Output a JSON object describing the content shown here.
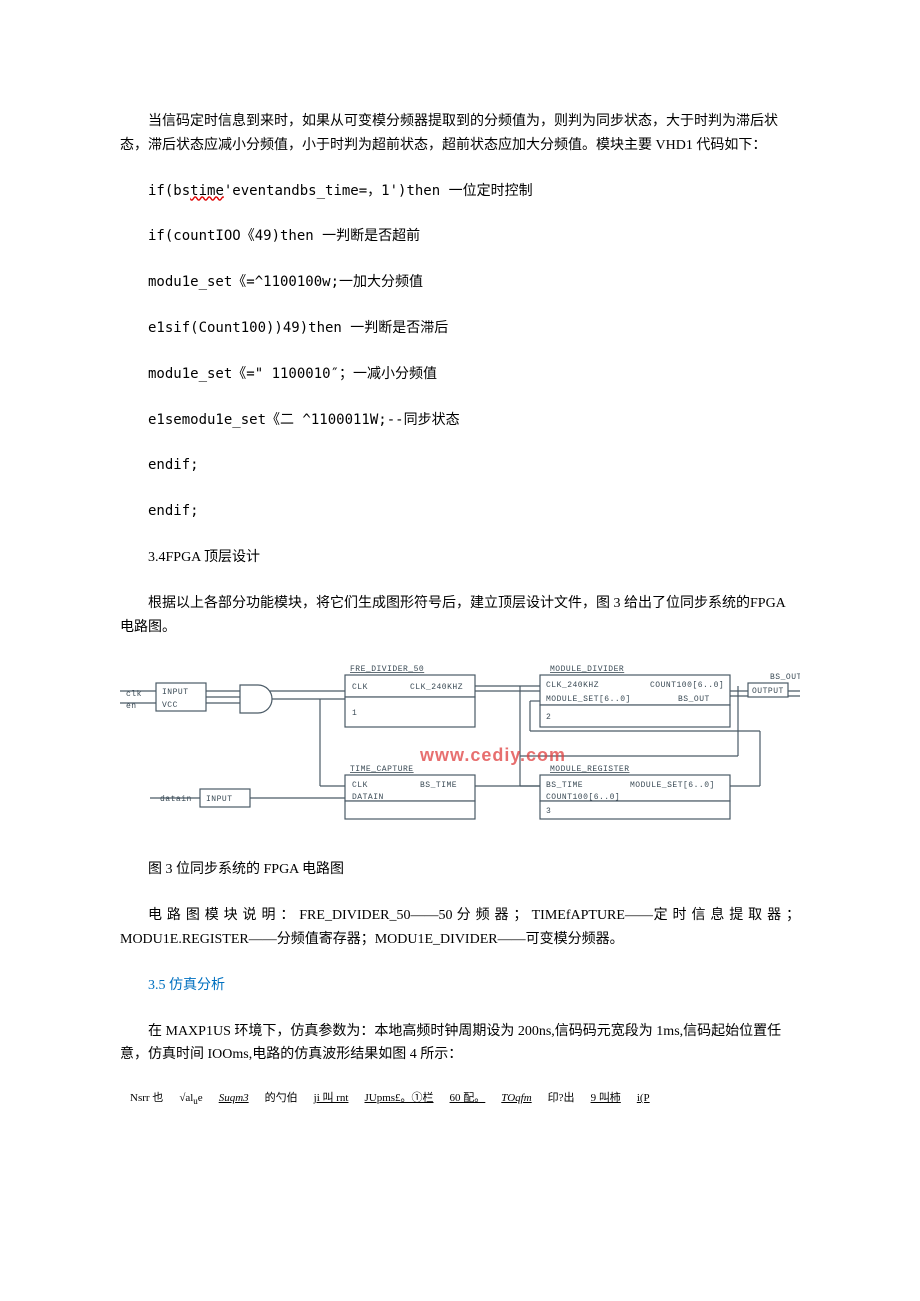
{
  "para_intro": "当信码定时信息到来时，如果从可变模分频器提取到的分频值为，则判为同步状态，大于时判为滞后状态，滞后状态应减小分频值，小于时判为超前状态，超前状态应加大分频值。模块主要 VHD1 代码如下：",
  "code": {
    "l1_a": "if(bs",
    "l1_b": "time",
    "l1_c": "'eventandbs_time=，1')then 一位定时控制",
    "l2": "if(countIOO《49)then 一判断是否超前",
    "l3": "modu1e_set《=^1100100w;一加大分频值",
    "l4": "e1sif(Count100))49)then 一判断是否滞后",
    "l5": "modu1e_set《=\" 1100010″；一减小分频值",
    "l6": "e1semodu1e_set《二 ^1100011W;--同步状态",
    "l7": "endif;",
    "l8": "endif;"
  },
  "heading34": "3.4FPGA 顶层设计",
  "para34": "根据以上各部分功能模块，将它们生成图形符号后，建立顶层设计文件，图 3 给出了位同步系统的FPGA 电路图。",
  "diagram": {
    "blocks": {
      "fre_divider": "FRE_DIVIDER_50",
      "module_divider": "MODULE_DIVIDER",
      "time_capture": "TIME_CAPTURE",
      "module_register": "MODULE_REGISTER"
    },
    "ports": {
      "clk": "clk",
      "en": "en",
      "datain": "datain",
      "bs_out_pin": "BS_OUT",
      "clk_port": "CLK",
      "clk_240khz": "CLK_240KHZ",
      "module_set": "MODULE_SET[6..0]",
      "count100": "COUNT100[6..0]",
      "bs_out": "BS_OUT",
      "bs_time": "BS_TIME",
      "datain_port": "DATAIN",
      "input": "INPUT",
      "vcc": "VCC",
      "output": "OUTPUT"
    },
    "watermark": "www.cediy.com"
  },
  "caption3": "图 3 位同步系统的 FPGA 电路图",
  "para_desc": "电 路 图 模 块 说 明 ： FRE_DIVIDER_50——50 分 频 器 ； TIMEfAPTURE——定 时 信 息 提 取 器 ；MODU1E.REGISTER——分频值寄存器；MODU1E_DIVIDER——可变模分频器。",
  "heading35": "3.5 仿真分析",
  "para35": "在 MAXP1US 环境下，仿真参数为：本地高频时钟周期设为 200ns,信码码元宽段为 1ms,信码起始位置任意，仿真时间 IOOms,电路的仿真波形结果如图 4 所示：",
  "footer": {
    "f1": "Nsrr 也",
    "f2a": "√al",
    "f2b": "u",
    "f2c": "e",
    "f3": "Suqm3",
    "f4": "的勺伯",
    "f5": "ji 叫 rnt",
    "f6": "JUpms£。①栏",
    "f7": "60 配。",
    "f8": "TOqfm",
    "f9": "印?出",
    "f10": "9 叫柿",
    "f11": "i(P"
  }
}
